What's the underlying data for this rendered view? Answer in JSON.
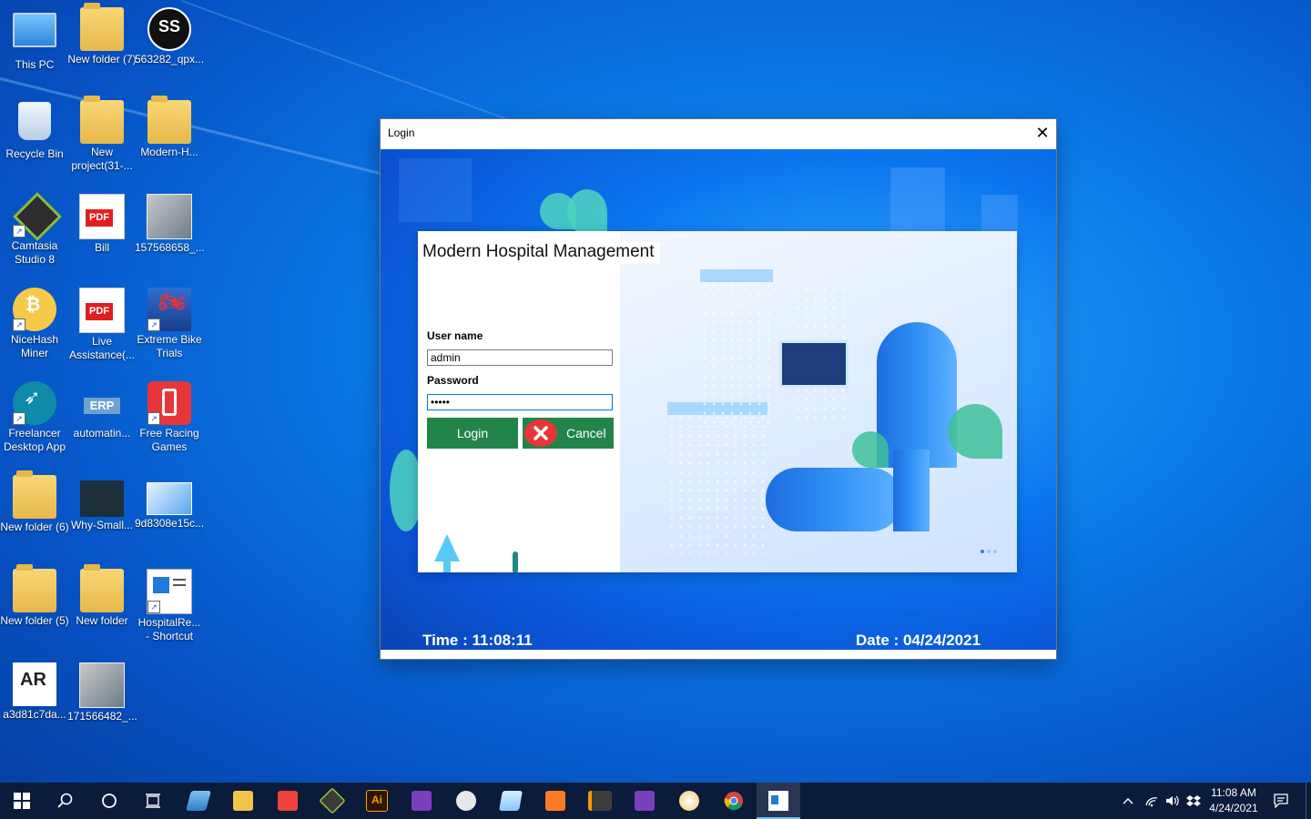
{
  "desktop": {
    "icons": [
      {
        "label": "This PC"
      },
      {
        "label": "New folder (7)"
      },
      {
        "label": "563282_qpx..."
      },
      {
        "label": "Recycle Bin"
      },
      {
        "label": "New project(31-..."
      },
      {
        "label": "Modern-H..."
      },
      {
        "label": "Camtasia Studio 8"
      },
      {
        "label": "Bill"
      },
      {
        "label": "157568658_..."
      },
      {
        "label": "NiceHash Miner"
      },
      {
        "label": "Live Assistance(..."
      },
      {
        "label": "Extreme Bike Trials"
      },
      {
        "label": "Freelancer Desktop App"
      },
      {
        "label": "automatin..."
      },
      {
        "label": "Free Racing Games"
      },
      {
        "label": "New folder (6)"
      },
      {
        "label": "Why-Small..."
      },
      {
        "label": "9d8308e15c..."
      },
      {
        "label": "New folder (5)"
      },
      {
        "label": "New folder"
      },
      {
        "label": "HospitalRe... - Shortcut"
      },
      {
        "label": "a3d81c7da..."
      },
      {
        "label": "171566482_..."
      }
    ],
    "pdf_badge": "PDF",
    "erp_badge": "ERP",
    "ss_badge": "SS",
    "ar_badge": "AR"
  },
  "window": {
    "title": "Login",
    "close_glyph": "✕",
    "app_title": "Modern Hospital Management",
    "username_label": "User name",
    "username_value": "admin",
    "password_label": "Password",
    "password_value": "•••••",
    "login_label": "Login",
    "cancel_label": "Cancel",
    "time_text": "Time : 11:08:11",
    "date_text": "Date :  04/24/2021"
  },
  "taskbar": {
    "clock_time": "11:08 AM",
    "clock_date": "4/24/2021",
    "ai_badge": "Ai",
    "colors": {
      "background": "#0b1b3a",
      "accent": "#76b9ed"
    }
  },
  "colors": {
    "button_green": "#23844a",
    "cancel_red": "#e8353a",
    "window_blue": "#0a76ee"
  }
}
